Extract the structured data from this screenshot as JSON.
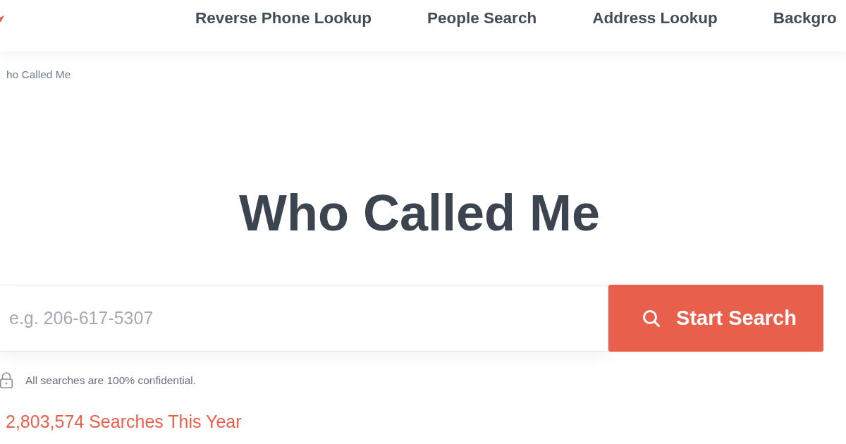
{
  "nav": {
    "links": [
      "Reverse Phone Lookup",
      "People Search",
      "Address Lookup",
      "Backgro"
    ]
  },
  "breadcrumb": {
    "current": "ho Called Me"
  },
  "hero": {
    "title": "Who Called Me"
  },
  "search": {
    "placeholder": "e.g. 206-617-5307",
    "button": "Start Search",
    "note": "All searches are 100% confidential."
  },
  "counter": "2,803,574 Searches This Year"
}
